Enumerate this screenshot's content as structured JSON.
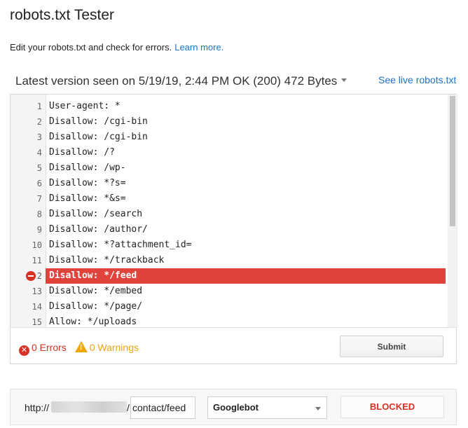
{
  "header": {
    "title": "robots.txt Tester",
    "subtitle": "Edit your robots.txt and check for errors.",
    "learn_more": "Learn more."
  },
  "version_bar": {
    "latest_version": "Latest version seen on 5/19/19, 2:44 PM OK (200) 472 Bytes",
    "see_live": "See live robots.txt"
  },
  "editor": {
    "lines": [
      {
        "num": "1",
        "text": "User-agent: *"
      },
      {
        "num": "2",
        "text": "Disallow: /cgi-bin"
      },
      {
        "num": "3",
        "text": "Disallow: /cgi-bin"
      },
      {
        "num": "4",
        "text": "Disallow: /?"
      },
      {
        "num": "5",
        "text": "Disallow: /wp-"
      },
      {
        "num": "6",
        "text": "Disallow: *?s="
      },
      {
        "num": "7",
        "text": "Disallow: *&s="
      },
      {
        "num": "8",
        "text": "Disallow: /search"
      },
      {
        "num": "9",
        "text": "Disallow: /author/"
      },
      {
        "num": "10",
        "text": "Disallow: *?attachment_id="
      },
      {
        "num": "11",
        "text": "Disallow: */trackback"
      },
      {
        "num": "2",
        "text": "Disallow: */feed",
        "blocked": true
      },
      {
        "num": "13",
        "text": "Disallow: */embed"
      },
      {
        "num": "14",
        "text": "Disallow: */page/"
      },
      {
        "num": "15",
        "text": "Allow: */uploads"
      }
    ]
  },
  "status": {
    "errors": "0 Errors",
    "warnings": "0 Warnings",
    "submit": "Submit"
  },
  "test": {
    "url_prefix": "http://",
    "url_slash": "/",
    "path_value": "contact/feed",
    "user_agent": "Googlebot",
    "result": "BLOCKED"
  },
  "colors": {
    "link": "#1a73c8",
    "error": "#d93025",
    "warning": "#e8a317",
    "highlight": "#e0433b"
  }
}
